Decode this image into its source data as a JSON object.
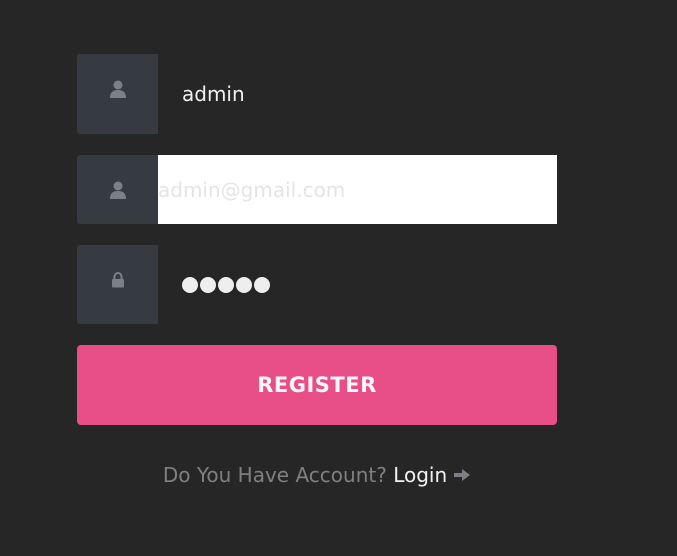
{
  "form": {
    "username": {
      "value": "admin",
      "icon": "user-icon"
    },
    "email": {
      "placeholder": "admin@gmail.com",
      "value": "",
      "icon": "user-icon"
    },
    "password": {
      "masked_length": 5,
      "icon": "lock-icon"
    },
    "register_label": "REGISTER"
  },
  "footer": {
    "question": "Do You Have Account?",
    "login_label": "Login",
    "login_icon": "arrow-right-icon"
  },
  "colors": {
    "background": "#262626",
    "icon_box": "#363a41",
    "accent": "#e84e88"
  }
}
